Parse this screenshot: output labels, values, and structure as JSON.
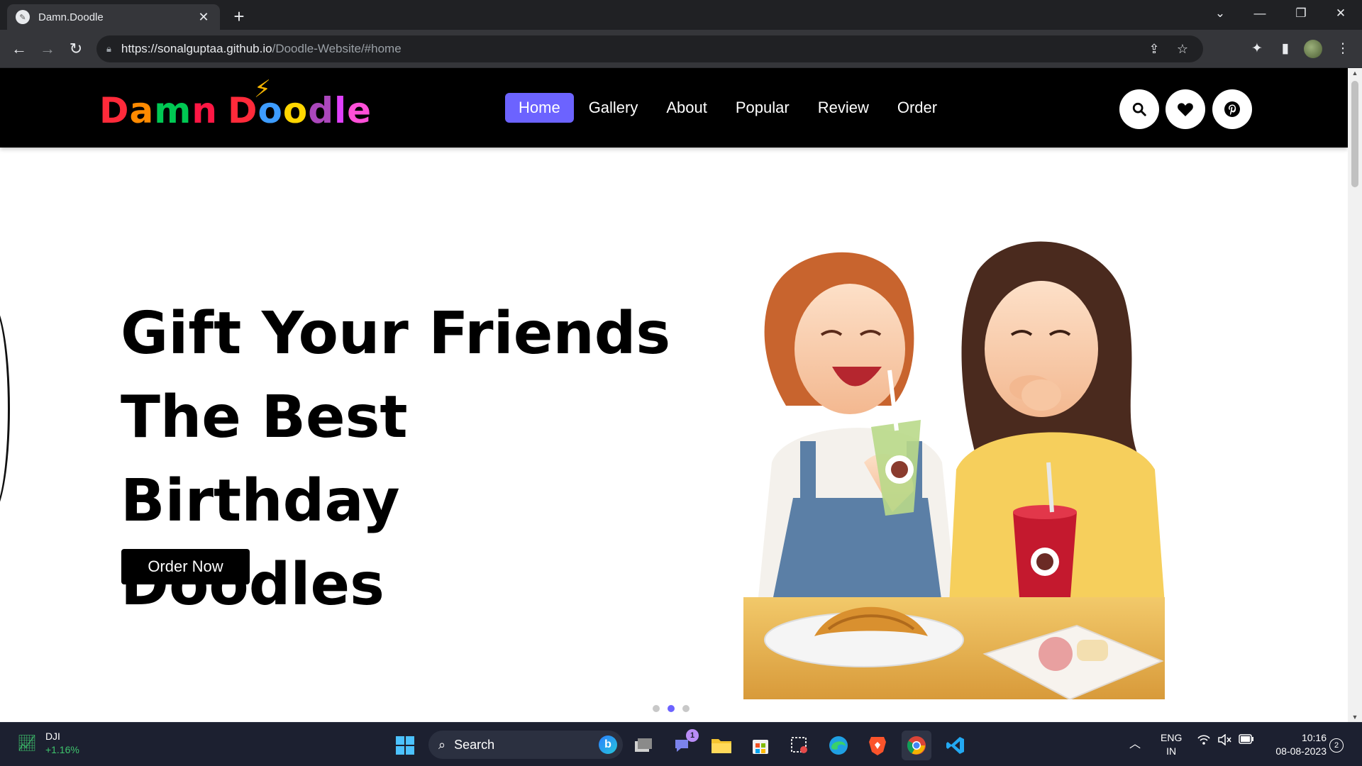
{
  "browser": {
    "tab_title": "Damn.Doodle",
    "tab_close": "✕",
    "new_tab": "+",
    "url_host": "https://sonalguptaa.github.io",
    "url_path": "/Doodle-Website/#home",
    "window_controls": {
      "dropdown": "⌄",
      "minimize": "—",
      "restore": "❐",
      "close": "✕"
    }
  },
  "site": {
    "logo_text": "Damn Doodle",
    "logo_colors": [
      "#ff2a3a",
      "#ff8a00",
      "#00c853",
      "#ff1744",
      "#ff2a3a",
      "#3d9cff",
      "#ffd600",
      "#ab47bc",
      "#e040fb",
      "#ff4fd8"
    ],
    "accent_color": "#6c63ff",
    "nav": [
      {
        "label": "Home",
        "active": true
      },
      {
        "label": "Gallery",
        "active": false
      },
      {
        "label": "About",
        "active": false
      },
      {
        "label": "Popular",
        "active": false
      },
      {
        "label": "Review",
        "active": false
      },
      {
        "label": "Order",
        "active": false
      }
    ],
    "header_icons": [
      "search-icon",
      "heart-icon",
      "pinterest-icon"
    ]
  },
  "hero": {
    "title_lines": [
      "Gift Your Friends",
      "The Best Birthday",
      "Doodles"
    ],
    "button_label": "Order Now",
    "slider_dots": 3,
    "active_dot": 1
  },
  "taskbar": {
    "widget_name": "DJI",
    "widget_change": "+1.16%",
    "search_label": "Search",
    "chat_badge": "1",
    "lang_line1": "ENG",
    "lang_line2": "IN",
    "time": "10:16",
    "date": "08-08-2023",
    "notifications": "2"
  }
}
